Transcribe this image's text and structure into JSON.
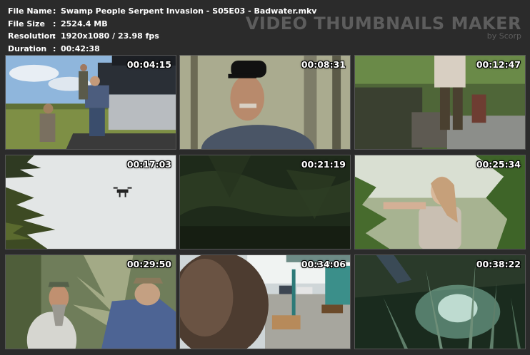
{
  "file_info": {
    "file_name_label": "File Name",
    "file_name": "Swamp People Serpent Invasion - S05E03 - Badwater.mkv",
    "file_size_label": "File Size",
    "file_size": "2524.4 MB",
    "resolution_label": "Resolution",
    "resolution": "1920x1080 / 23.98 fps",
    "duration_label": "Duration",
    "duration": "00:42:38",
    "separator": ":"
  },
  "brand": {
    "title": "VIDEO THUMBNAILS MAKER",
    "subtitle": "by Scorp"
  },
  "thumbnails": [
    {
      "timestamp": "00:04:15"
    },
    {
      "timestamp": "00:08:31"
    },
    {
      "timestamp": "00:12:47"
    },
    {
      "timestamp": "00:17:03"
    },
    {
      "timestamp": "00:21:19"
    },
    {
      "timestamp": "00:25:34"
    },
    {
      "timestamp": "00:29:50"
    },
    {
      "timestamp": "00:34:06"
    },
    {
      "timestamp": "00:38:22"
    }
  ]
}
